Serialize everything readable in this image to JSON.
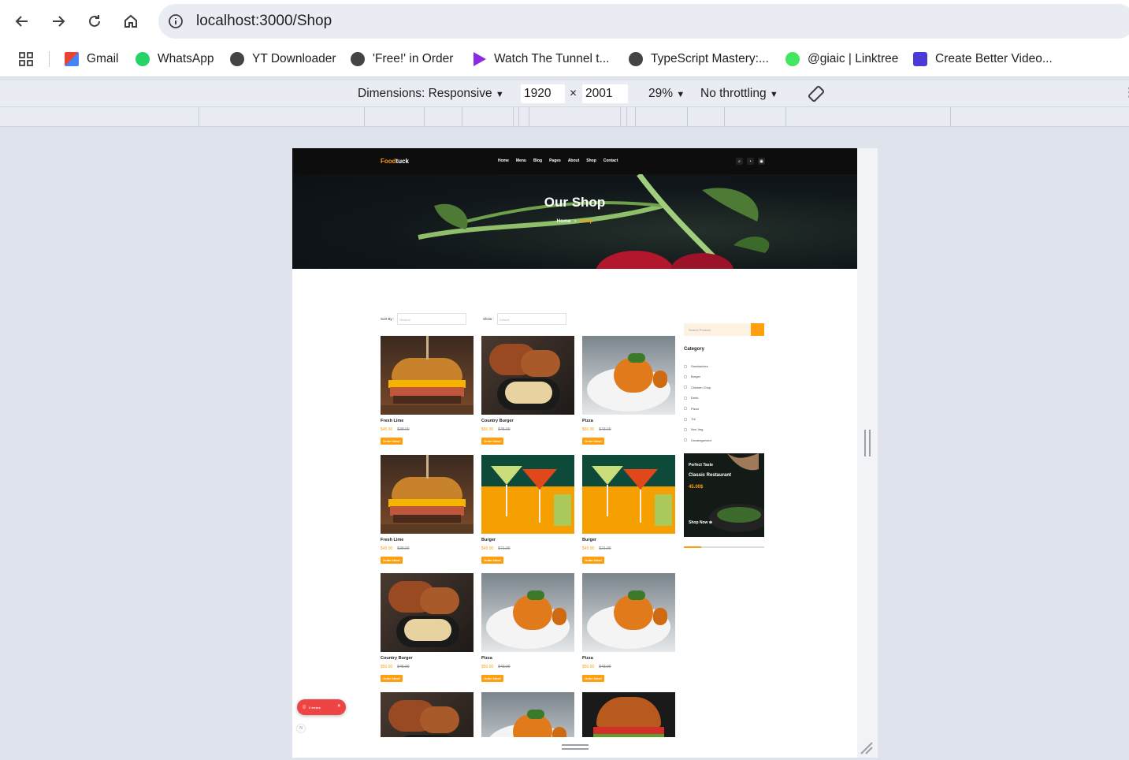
{
  "browser": {
    "url": "localhost:3000/Shop",
    "bookmarks": [
      {
        "label": "Gmail",
        "icon": "gmail-icon"
      },
      {
        "label": "WhatsApp",
        "icon": "whatsapp-icon"
      },
      {
        "label": "YT Downloader",
        "icon": "globe-icon"
      },
      {
        "label": "'Free!' in Order",
        "icon": "globe-icon"
      },
      {
        "label": "Watch The Tunnel t...",
        "icon": "play-icon"
      },
      {
        "label": "TypeScript Mastery:...",
        "icon": "globe-icon"
      },
      {
        "label": "@giaic | Linktree",
        "icon": "linktree-icon"
      },
      {
        "label": "Create Better Video...",
        "icon": "video-app-icon"
      }
    ]
  },
  "devtools": {
    "dimensions_label": "Dimensions: Responsive",
    "width": "1920",
    "times": "×",
    "height": "2001",
    "zoom": "29%",
    "throttling": "No throttling"
  },
  "site": {
    "logo_accent": "Food",
    "logo_rest": "tuck",
    "nav": [
      "Home",
      "Menu",
      "Blog",
      "Pages",
      "About",
      "Shop",
      "Contact"
    ],
    "hero_title": "Our Shop",
    "breadcrumb_home": "Home",
    "breadcrumb_sep": "›",
    "breadcrumb_current": "Shop",
    "sort_label": "Sort By :",
    "sort_value": "Newest",
    "show_label": "Show :",
    "show_value": "Default",
    "order_label": "Order Now!",
    "products": [
      {
        "name": "Fresh Lime",
        "price": "$45.00",
        "old": "$38.00",
        "img": "burger"
      },
      {
        "name": "Country Burger",
        "price": "$50.00",
        "old": "$45.00",
        "img": "chicken"
      },
      {
        "name": "Pizza",
        "price": "$50.00",
        "old": "$43.00",
        "img": "plate"
      },
      {
        "name": "Fresh Lime",
        "price": "$45.00",
        "old": "$38.00",
        "img": "burger"
      },
      {
        "name": "Burger",
        "price": "$45.00",
        "old": "$71.00",
        "img": "drinks"
      },
      {
        "name": "Burger",
        "price": "$45.00",
        "old": "$21.00",
        "img": "drinks"
      },
      {
        "name": "Country Burger",
        "price": "$50.00",
        "old": "$45.00",
        "img": "chicken"
      },
      {
        "name": "Pizza",
        "price": "$50.00",
        "old": "$43.00",
        "img": "plate"
      },
      {
        "name": "Pizza",
        "price": "$50.00",
        "old": "$43.00",
        "img": "plate"
      }
    ],
    "search_placeholder": "Search Product",
    "category_title": "Category",
    "categories": [
      "Sandwiches",
      "Burger",
      "Chicken Chup",
      "Drink",
      "Pizza",
      "Thi",
      "Non Veg",
      "Uncategorized"
    ],
    "promo": {
      "line1": "Perfect Taste",
      "line2": "Classic Restaurant",
      "price": "45.00$",
      "cta": "Shop Now"
    },
    "errors_label": "2 errors",
    "accent": "#ff9f0d"
  }
}
